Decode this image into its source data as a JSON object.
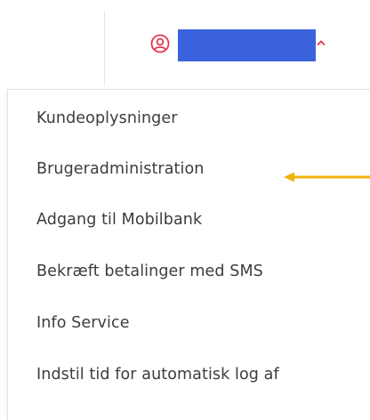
{
  "header": {
    "user_icon": "user-circle-icon",
    "user_name_redaction_color": "#3b63dd",
    "accent_color": "#e8344d",
    "caret_icon": "chevron-up-icon"
  },
  "menu": {
    "items": [
      {
        "label": "Kundeoplysninger"
      },
      {
        "label": "Brugeradministration"
      },
      {
        "label": "Adgang til Mobilbank"
      },
      {
        "label": "Bekræft betalinger med SMS"
      },
      {
        "label": "Info Service"
      },
      {
        "label": "Indstil tid for automatisk log af"
      }
    ]
  },
  "annotation": {
    "icon": "arrow-left-icon",
    "color": "#f2b10c",
    "points_to": "Brugeradministration"
  }
}
